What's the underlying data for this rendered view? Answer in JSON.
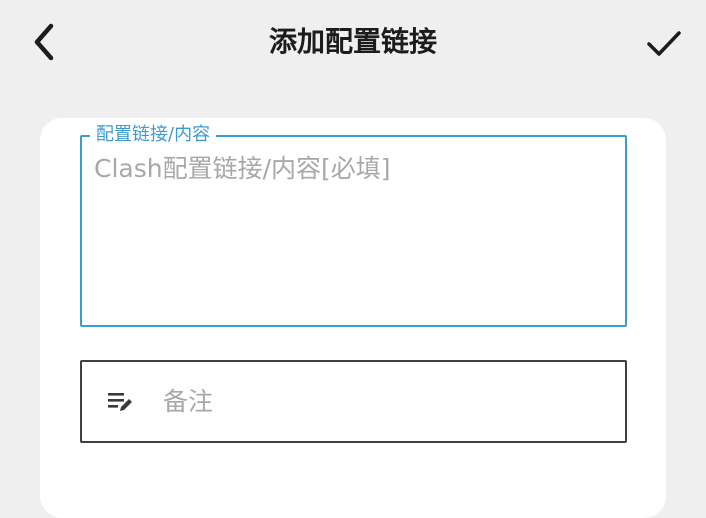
{
  "header": {
    "title": "添加配置链接",
    "back_icon": "chevron-left-icon",
    "confirm_icon": "checkmark-icon"
  },
  "form": {
    "link_field": {
      "label": "配置链接/内容",
      "placeholder": "Clash配置链接/内容[必填]",
      "value": ""
    },
    "note_field": {
      "icon": "notes-edit-icon",
      "placeholder": "备注",
      "value": ""
    }
  },
  "colors": {
    "background": "#efefef",
    "card": "#ffffff",
    "accent": "#3d9bd0",
    "placeholder": "#a8a8a8",
    "border_default": "#3f3f3f"
  }
}
